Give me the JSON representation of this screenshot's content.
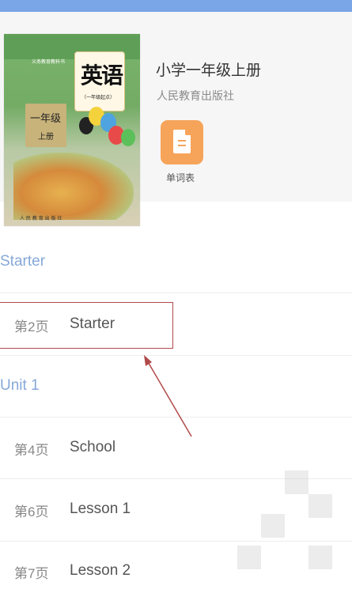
{
  "book": {
    "title": "小学一年级上册",
    "publisher": "人民教育出版社",
    "cover": {
      "series": "义务教育教科书",
      "title": "英语",
      "subtitle": "（一年级起点）",
      "grade": "一年级",
      "volume": "上册",
      "publisher": "人 民 教 育 出 版 社"
    }
  },
  "vocab_button": {
    "label": "单词表",
    "icon": "document-icon"
  },
  "colors": {
    "top_bar": "#7aa5e6",
    "section_title": "#86a8d8",
    "vocab_button": "#f6a45a",
    "annotation": "#b04a4a"
  },
  "sections": [
    {
      "title": "Starter",
      "items": [
        {
          "page": "第2页",
          "name": "Starter"
        }
      ]
    },
    {
      "title": "Unit 1",
      "items": [
        {
          "page": "第4页",
          "name": "School"
        },
        {
          "page": "第6页",
          "name": "Lesson 1"
        },
        {
          "page": "第7页",
          "name": "Lesson 2"
        }
      ]
    }
  ]
}
